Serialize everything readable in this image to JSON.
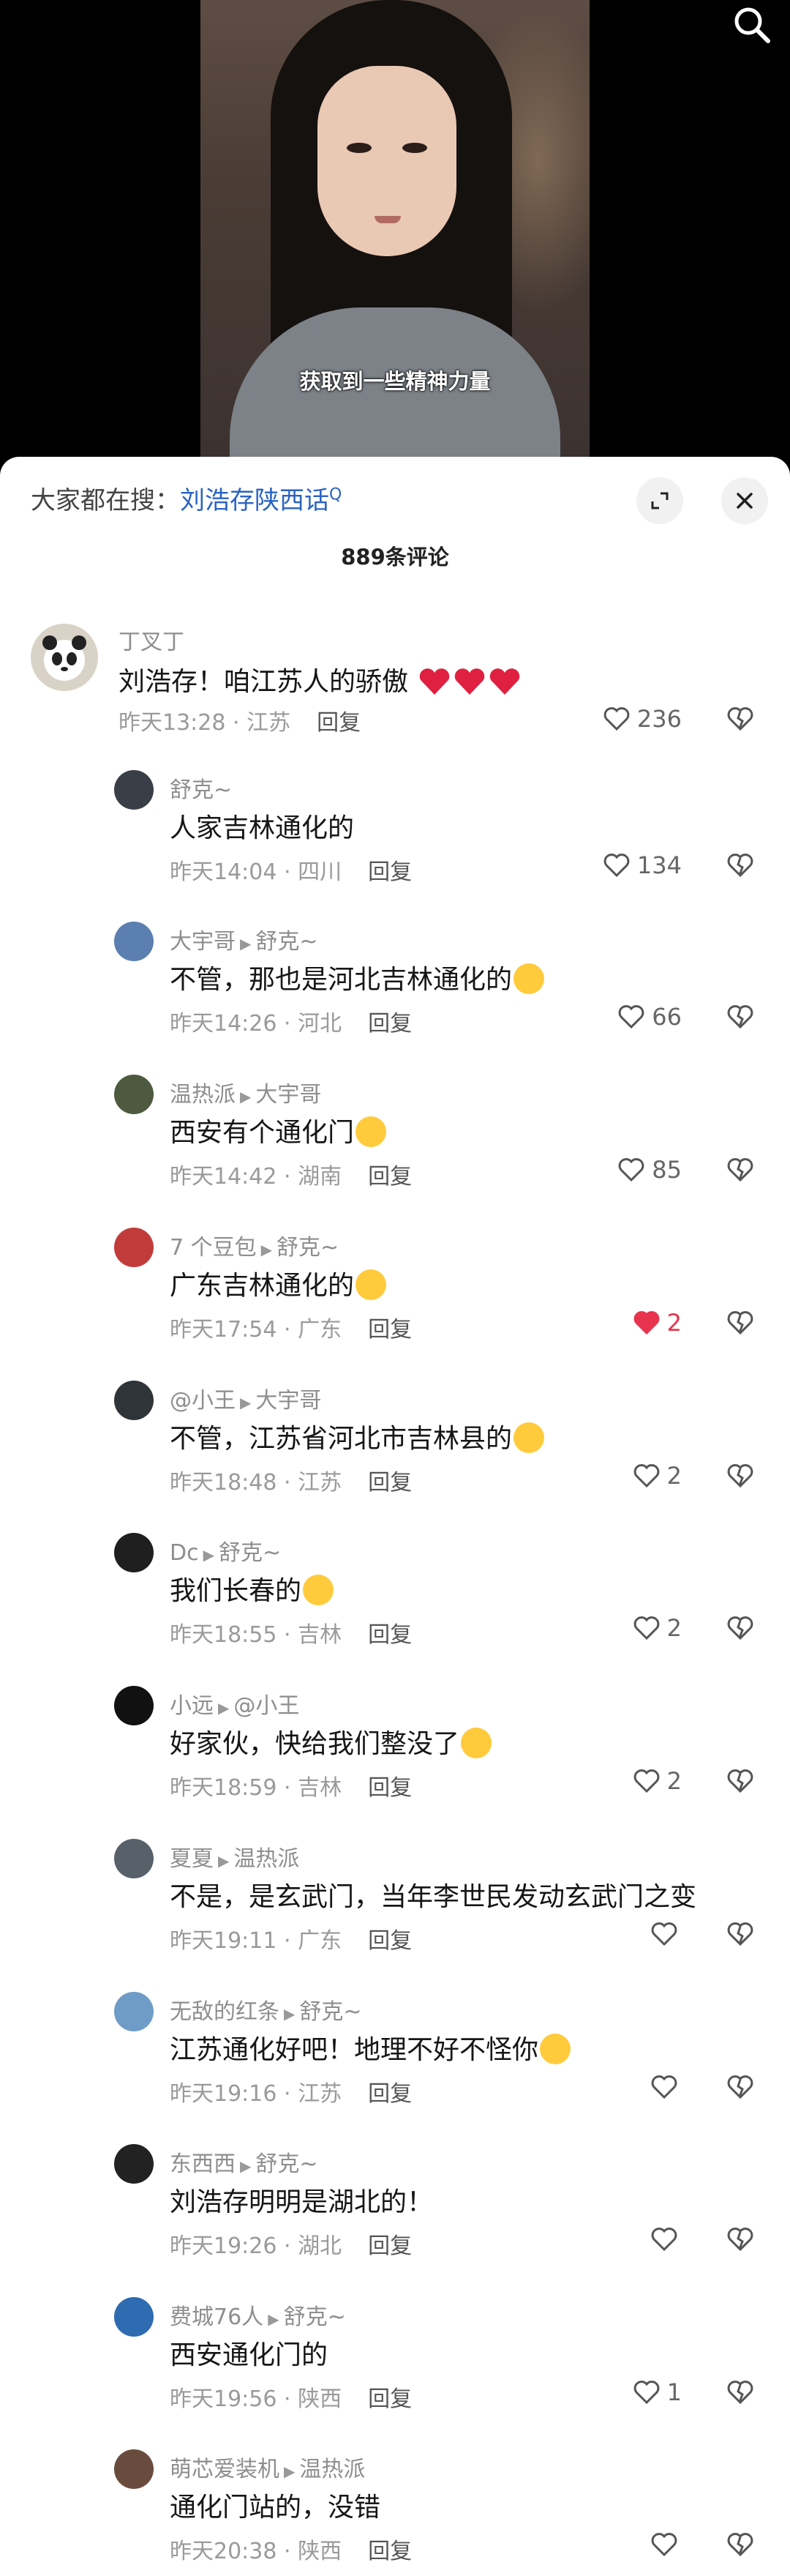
{
  "video": {
    "subtitle": "获取到一些精神力量"
  },
  "sheet": {
    "suggest_prefix": "大家都在搜：",
    "suggest_link": "刘浩存陕西话",
    "suggest_mini": "Q",
    "comment_count": "889条评论"
  },
  "comments": [
    {
      "author": "丁叉丁",
      "text": "刘浩存！咱江苏人的骄傲",
      "time": "昨天13:28",
      "loc": "江苏",
      "reply": "回复",
      "likes": "236"
    },
    {
      "author": "舒克~",
      "text": "人家吉林通化的",
      "time": "昨天14:04",
      "loc": "四川",
      "reply": "回复",
      "likes": "134"
    },
    {
      "author": "大宇哥",
      "to": "舒克~",
      "text": "不管，那也是河北吉林通化的",
      "time": "昨天14:26",
      "loc": "河北",
      "reply": "回复",
      "likes": "66"
    },
    {
      "author": "温热派",
      "to": "大宇哥",
      "text": "西安有个通化门",
      "time": "昨天14:42",
      "loc": "湖南",
      "reply": "回复",
      "likes": "85"
    },
    {
      "author": "7 个豆包",
      "to": "舒克~",
      "text": "广东吉林通化的",
      "time": "昨天17:54",
      "loc": "广东",
      "reply": "回复",
      "likes": "2"
    },
    {
      "author": "@小王",
      "to": "大宇哥",
      "text": "不管，江苏省河北市吉林县的",
      "time": "昨天18:48",
      "loc": "江苏",
      "reply": "回复",
      "likes": "2"
    },
    {
      "author": "Dc",
      "to": "舒克~",
      "text": "我们长春的",
      "time": "昨天18:55",
      "loc": "吉林",
      "reply": "回复",
      "likes": "2"
    },
    {
      "author": "小远",
      "to": "@小王",
      "text": "好家伙，快给我们整没了",
      "time": "昨天18:59",
      "loc": "吉林",
      "reply": "回复",
      "likes": "2"
    },
    {
      "author": "夏夏",
      "to": "温热派",
      "text": "不是，是玄武门，当年李世民发动玄武门之变",
      "time": "昨天19:11",
      "loc": "广东",
      "reply": "回复",
      "likes": ""
    },
    {
      "author": "无敌的红条",
      "to": "舒克~",
      "text": "江苏通化好吧！地理不好不怪你",
      "time": "昨天19:16",
      "loc": "江苏",
      "reply": "回复",
      "likes": ""
    },
    {
      "author": "东西西",
      "to": "舒克~",
      "text": "刘浩存明明是湖北的！",
      "time": "昨天19:26",
      "loc": "湖北",
      "reply": "回复",
      "likes": ""
    },
    {
      "author": "费城76人",
      "to": "舒克~",
      "text": "西安通化门的",
      "time": "昨天19:56",
      "loc": "陕西",
      "reply": "回复",
      "likes": "1"
    },
    {
      "author": "萌芯爱装机",
      "to": "温热派",
      "text": "通化门站的，没错",
      "time": "昨天20:38",
      "loc": "陕西",
      "reply": "回复",
      "likes": ""
    }
  ]
}
